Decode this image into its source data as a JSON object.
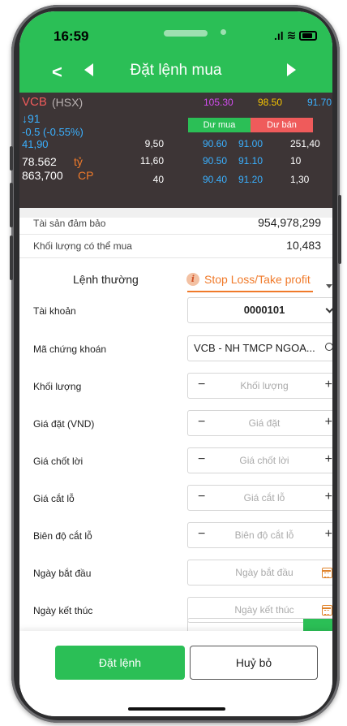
{
  "status_bar": {
    "time": "16:59",
    "signal": ".ıl",
    "wifi": "≋"
  },
  "header": {
    "title": "Đặt lệnh mua"
  },
  "market": {
    "symbol": "VCB",
    "exchange": "(HSX)",
    "ceiling": "105.30",
    "reference": "98.50",
    "third_price": "91.70",
    "last_price": "↓91",
    "change": "-0.5 (-0.55%)",
    "last_sub": "41,90",
    "value": "78.562",
    "value_unit": "tỷ",
    "volume": "863,700",
    "volume_unit": "CP",
    "buy_label": "Dư mua",
    "sell_label": "Dư bán",
    "depth": [
      {
        "bid_vol": "9,50",
        "bid": "90.60",
        "ask": "91.00",
        "ask_vol": "251,40"
      },
      {
        "bid_vol": "11,60",
        "bid": "90.50",
        "ask": "91.10",
        "ask_vol": "10"
      },
      {
        "bid_vol": "40",
        "bid": "90.40",
        "ask": "91.20",
        "ask_vol": "1,30"
      }
    ],
    "colors": {
      "ceiling": "#d34cf0",
      "reference": "#f5c400",
      "floor": "#3ab0ff",
      "up": "#2bd45e",
      "down": "#ef5b5b",
      "unit": "#f07a2a"
    }
  },
  "account_info": {
    "collateral_label": "Tài sản đảm bảo",
    "collateral_value": "954,978,299",
    "max_qty_label": "Khối lượng có thể mua",
    "max_qty_value": "10,483"
  },
  "order_type": {
    "normal": "Lệnh thường",
    "stop": "Stop Loss/Take profit"
  },
  "form": {
    "account_label": "Tài khoản",
    "account_value": "0000101",
    "symbol_label": "Mã chứng khoán",
    "symbol_value": "VCB - NH TMCP NGOA...",
    "qty_label": "Khối lượng",
    "qty_placeholder": "Khối lượng",
    "price_label": "Giá đặt (VND)",
    "price_placeholder": "Giá đặt",
    "tp_label": "Giá chốt lời",
    "tp_placeholder": "Giá chốt lời",
    "sl_label": "Giá cắt lỗ",
    "sl_placeholder": "Giá cắt lỗ",
    "sl_range_label": "Biên độ cắt lỗ",
    "sl_range_placeholder": "Biên độ cắt lỗ",
    "start_label": "Ngày bắt đầu",
    "start_placeholder": "Ngày bắt đầu",
    "end_label": "Ngày kết thúc",
    "end_placeholder": "Ngày kết thúc",
    "minus": "−",
    "plus": "+"
  },
  "actions": {
    "submit": "Đặt lệnh",
    "cancel": "Huỷ bỏ"
  }
}
